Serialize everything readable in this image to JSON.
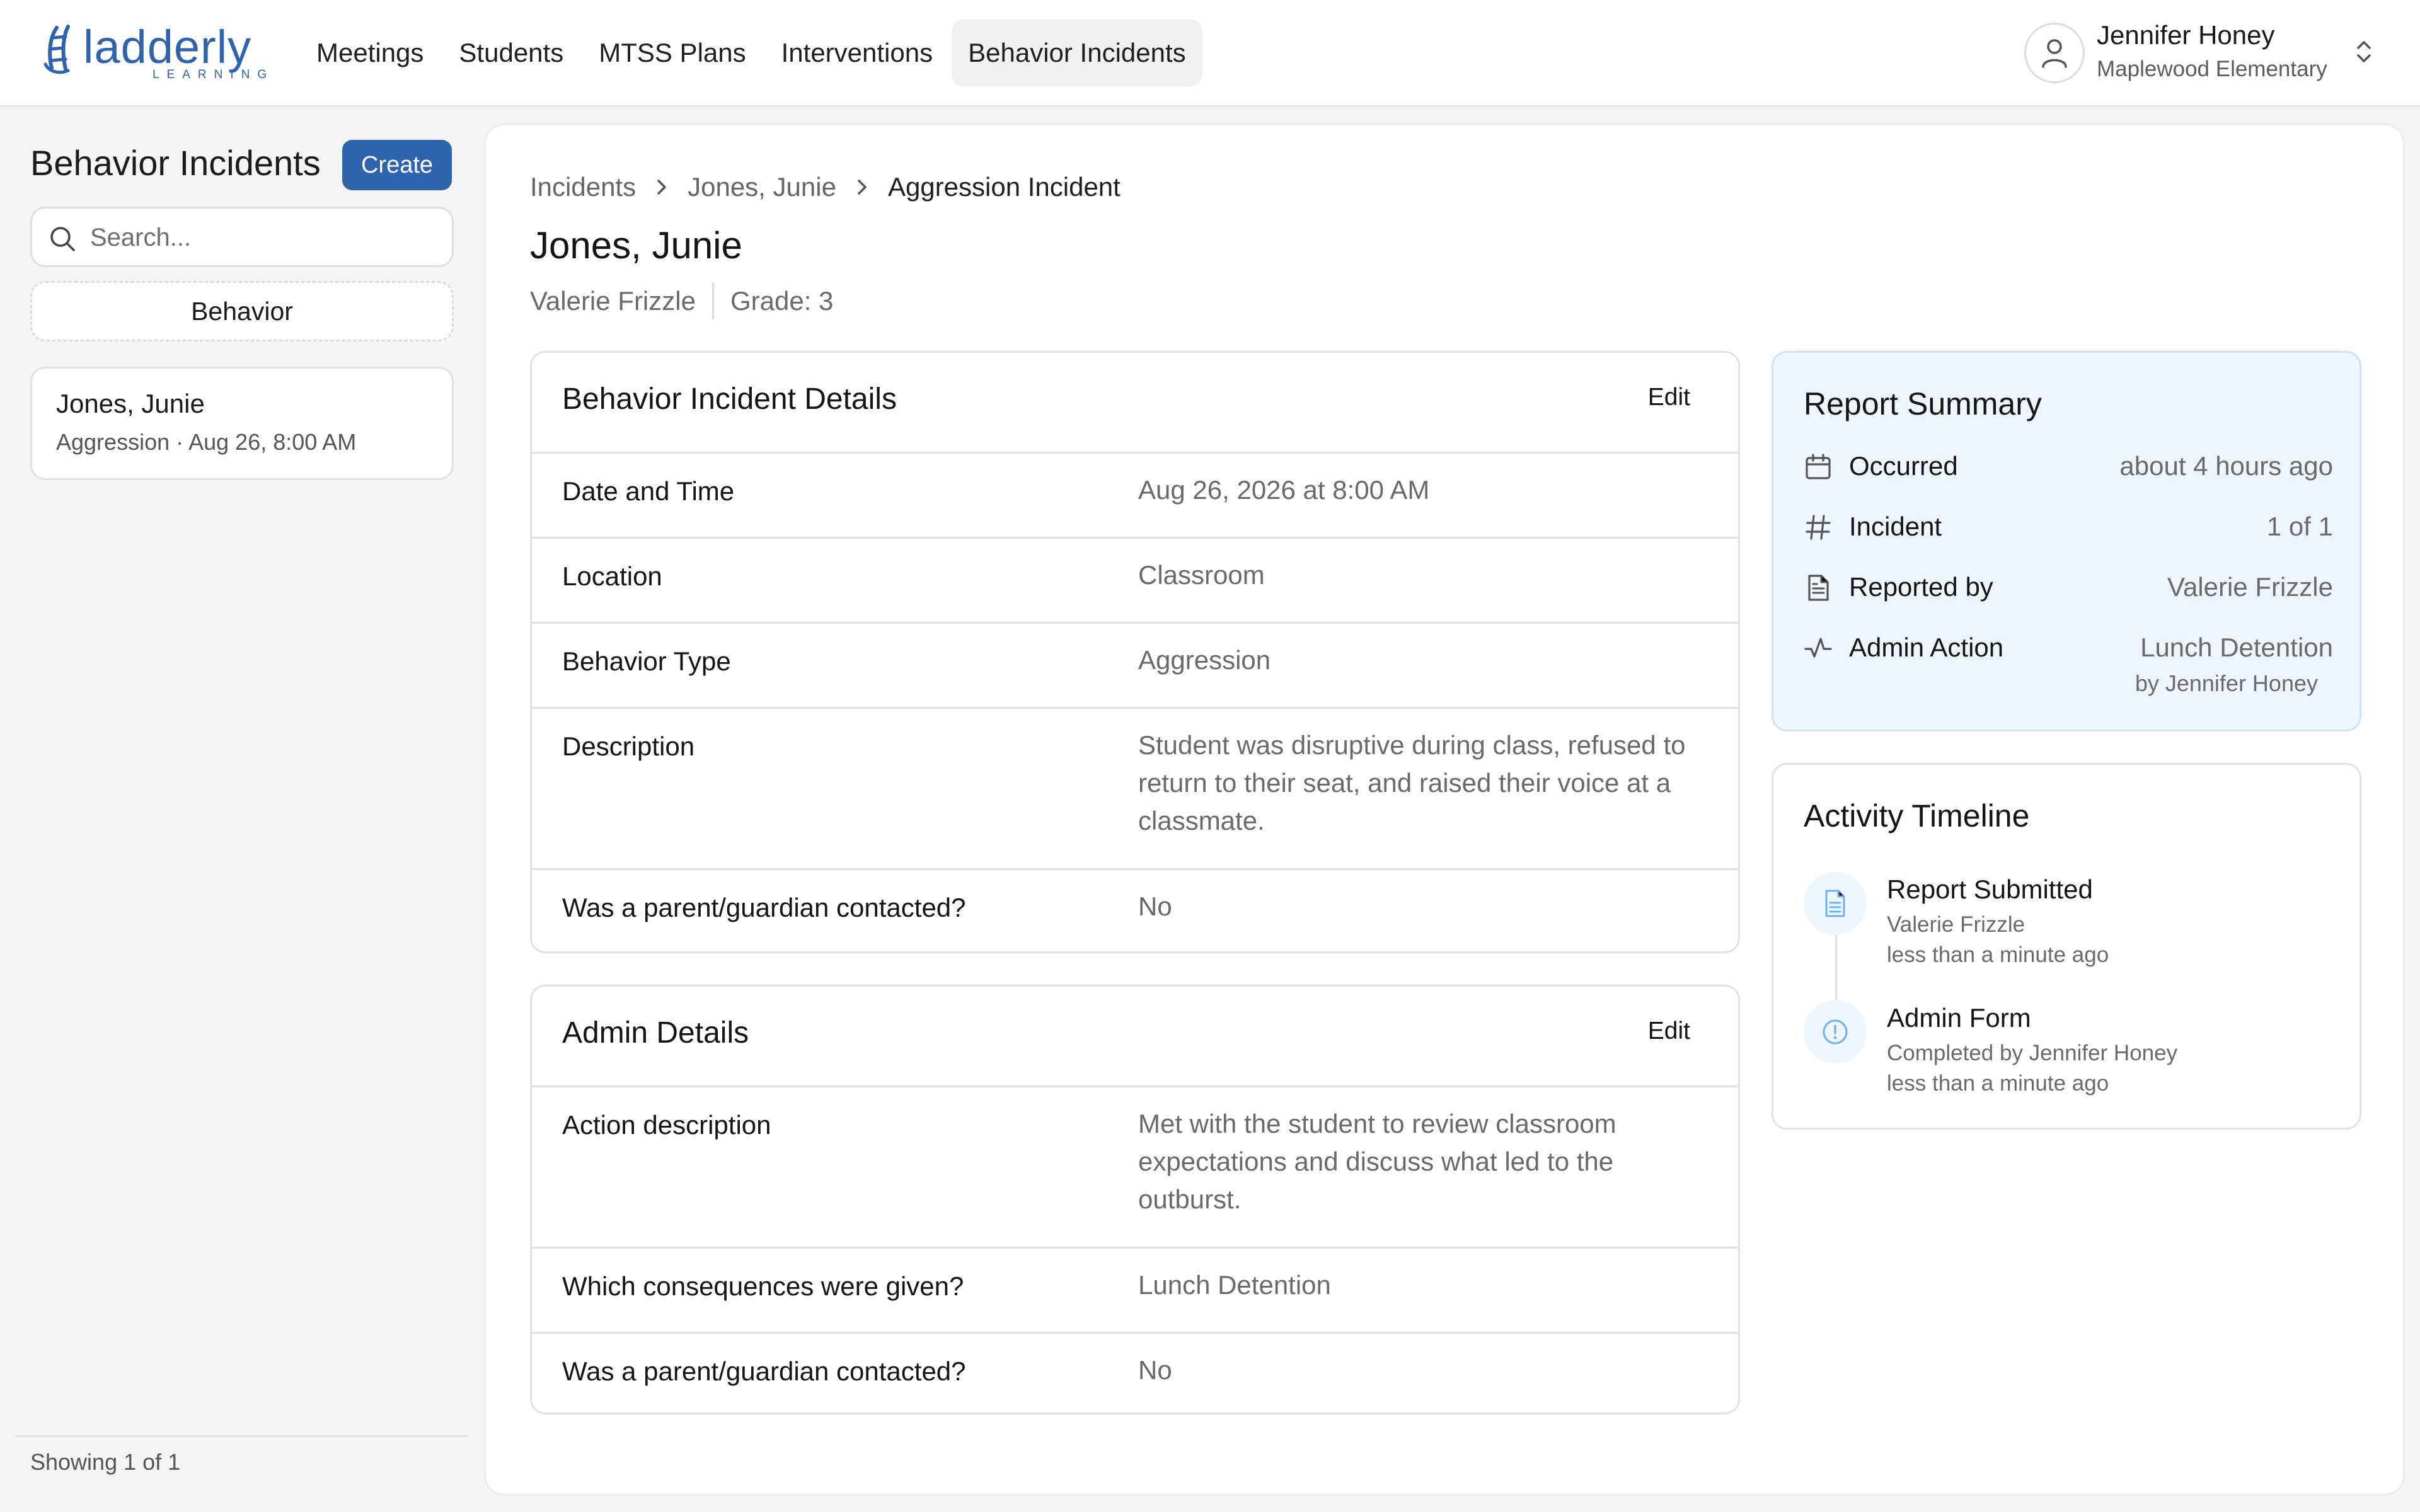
{
  "app": {
    "logo_text": "ladderly",
    "logo_sub": "LEARNING",
    "brand_color": "#2e64ae",
    "nav": [
      {
        "label": "Meetings"
      },
      {
        "label": "Students"
      },
      {
        "label": "MTSS Plans"
      },
      {
        "label": "Interventions"
      },
      {
        "label": "Behavior Incidents",
        "active": true
      }
    ],
    "user": {
      "name": "Jennifer Honey",
      "school": "Maplewood Elementary",
      "icon": "user-icon"
    }
  },
  "sidebar": {
    "title": "Behavior Incidents",
    "create_label": "Create",
    "search_placeholder": "Search...",
    "filter_label": "Behavior",
    "items": [
      {
        "name": "Jones, Junie",
        "meta": "Aggression · Aug 26, 8:00 AM"
      }
    ],
    "footer": "Showing 1 of 1"
  },
  "main": {
    "breadcrumb": [
      "Incidents",
      "Jones, Junie",
      "Aggression Incident"
    ],
    "title": "Jones, Junie",
    "reporter": "Valerie Frizzle",
    "grade": "Grade: 3",
    "incident_details": {
      "title": "Behavior Incident Details",
      "edit_label": "Edit",
      "rows": [
        {
          "label": "Date and Time",
          "value": "Aug 26, 2026 at 8:00 AM"
        },
        {
          "label": "Location",
          "value": "Classroom"
        },
        {
          "label": "Behavior Type",
          "value": "Aggression"
        },
        {
          "label": "Description",
          "value": "Student was disruptive during class, refused to return to their seat, and raised their voice at a classmate."
        },
        {
          "label": "Was a parent/guardian contacted?",
          "value": "No"
        }
      ]
    },
    "admin_details": {
      "title": "Admin Details",
      "edit_label": "Edit",
      "rows": [
        {
          "label": "Action description",
          "value": "Met with the student to review classroom expectations and discuss what led to the outburst."
        },
        {
          "label": "Which consequences were given?",
          "value": "Lunch Detention"
        },
        {
          "label": "Was a parent/guardian contacted?",
          "value": "No"
        }
      ]
    },
    "report_summary": {
      "title": "Report Summary",
      "rows": [
        {
          "icon": "calendar-icon",
          "label": "Occurred",
          "value": "about 4 hours ago"
        },
        {
          "icon": "hash-icon",
          "label": "Incident",
          "value": "1 of 1"
        },
        {
          "icon": "document-icon",
          "label": "Reported by",
          "value": "Valerie Frizzle"
        },
        {
          "icon": "activity-icon",
          "label": "Admin Action",
          "value": "Lunch Detention",
          "sub": "by Jennifer Honey"
        }
      ]
    },
    "activity": {
      "title": "Activity Timeline",
      "items": [
        {
          "icon": "document-icon",
          "title": "Report Submitted",
          "by": "Valerie Frizzle",
          "when": "less than a minute ago"
        },
        {
          "icon": "alert-circle-icon",
          "title": "Admin Form",
          "by": "Completed by Jennifer Honey",
          "when": "less than a minute ago"
        }
      ]
    }
  }
}
